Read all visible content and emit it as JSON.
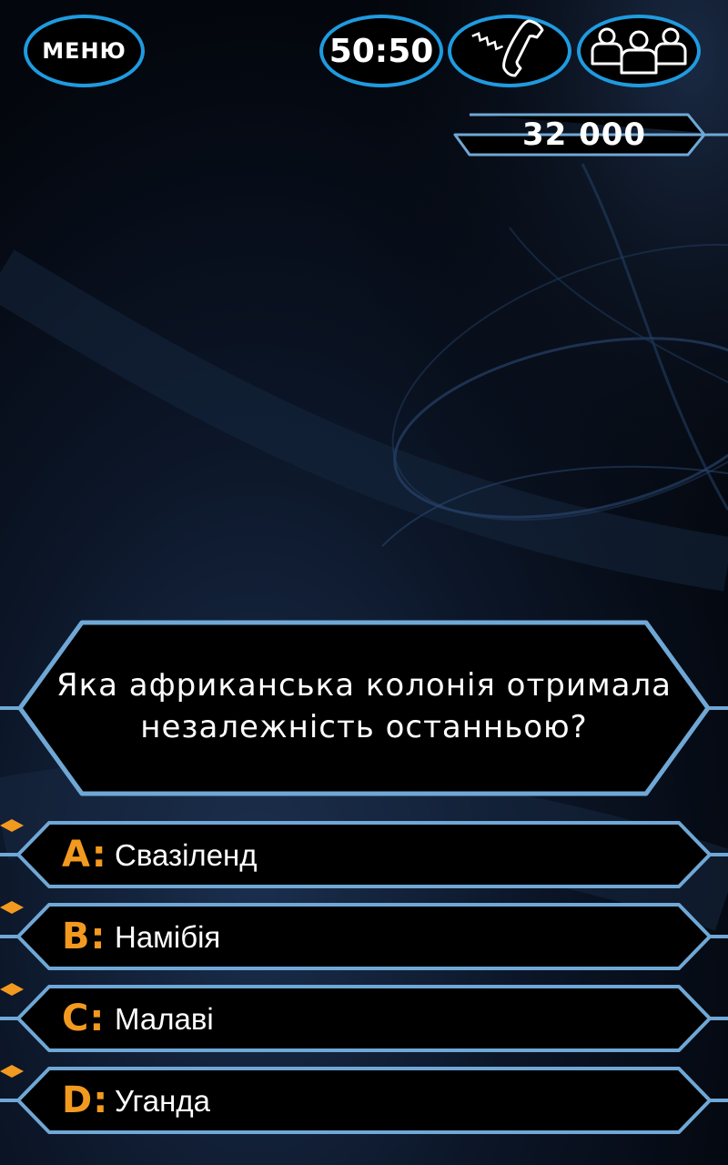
{
  "header": {
    "menu_label": "МЕНЮ",
    "fifty_fifty_label": "50:50",
    "phone_icon": "phone-a-friend-icon",
    "audience_icon": "ask-audience-icon",
    "prize": "32 000"
  },
  "question": {
    "text": "Яка африканська колонія отримала незалежність останньою?"
  },
  "answers": [
    {
      "letter": "A:",
      "text": "Свазіленд"
    },
    {
      "letter": "B:",
      "text": "Намібія"
    },
    {
      "letter": "C:",
      "text": "Малаві"
    },
    {
      "letter": "D:",
      "text": "Уганда"
    }
  ],
  "colors": {
    "frame": "#6fa8d6",
    "button_border": "#1f9be0",
    "letter": "#f29a1f",
    "background": "#05080f"
  }
}
